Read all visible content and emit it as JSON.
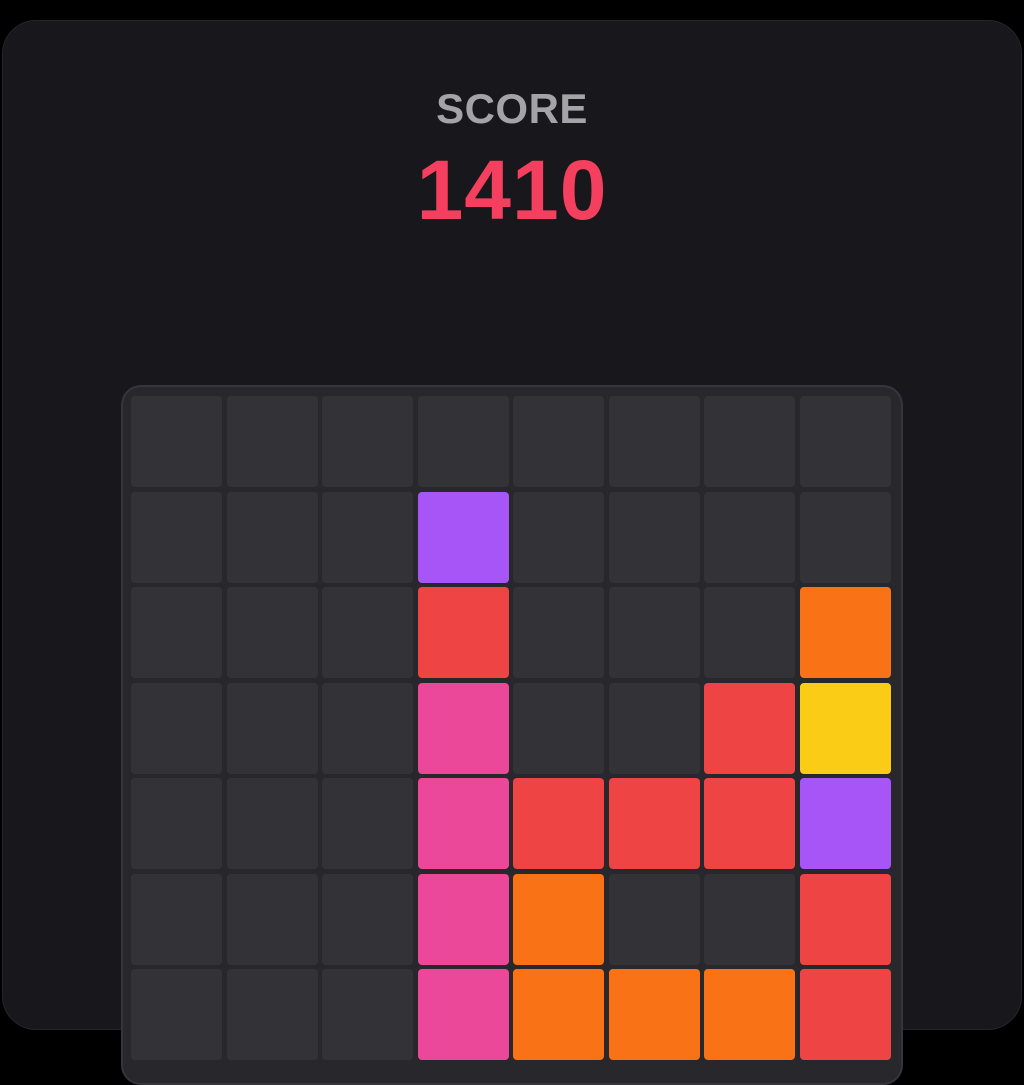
{
  "score": {
    "label": "SCORE",
    "value": "1410"
  },
  "palette": {
    "empty": "#323237",
    "purple": "#a855f7",
    "red": "#ef4444",
    "pink": "#ec4899",
    "orange": "#f97316",
    "yellow": "#facc15"
  },
  "board": {
    "columns": 8,
    "visible_rows": 7,
    "rows": [
      [
        null,
        null,
        null,
        null,
        null,
        null,
        null,
        null
      ],
      [
        null,
        null,
        null,
        "purple",
        null,
        null,
        null,
        null
      ],
      [
        null,
        null,
        null,
        "red",
        null,
        null,
        null,
        "orange"
      ],
      [
        null,
        null,
        null,
        "pink",
        null,
        null,
        "red",
        "yellow"
      ],
      [
        null,
        null,
        null,
        "pink",
        "red",
        "red",
        "red",
        "purple"
      ],
      [
        null,
        null,
        null,
        "pink",
        "orange",
        null,
        null,
        "red"
      ],
      [
        null,
        null,
        null,
        "pink",
        "orange",
        "orange",
        "orange",
        "red"
      ]
    ]
  }
}
